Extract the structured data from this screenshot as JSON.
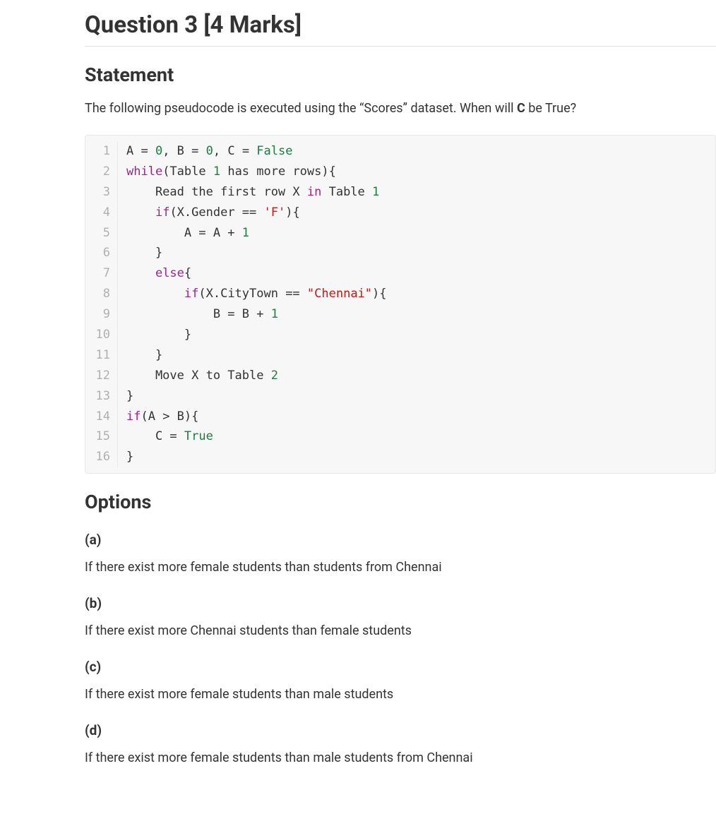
{
  "title": "Question 3 [4 Marks]",
  "sections": {
    "statement_heading": "Statement",
    "statement_text_pre": "The following pseudocode is executed using the “Scores” dataset. When will ",
    "statement_text_bold": "C",
    "statement_text_post": " be True?",
    "options_heading": "Options"
  },
  "code": {
    "lines": [
      {
        "n": "1",
        "html": "A = <span class='tok-num'>0</span>, B = <span class='tok-num'>0</span>, C = <span class='tok-const'>False</span>"
      },
      {
        "n": "2",
        "html": "<span class='tok-kw'>while</span>(Table <span class='tok-num'>1</span> has more rows){"
      },
      {
        "n": "3",
        "html": "    Read the first row X <span class='tok-kw'>in</span> Table <span class='tok-num'>1</span>"
      },
      {
        "n": "4",
        "html": "    <span class='tok-kw'>if</span>(X.Gender == <span class='tok-str'>'F'</span>){"
      },
      {
        "n": "5",
        "html": "        A = A + <span class='tok-num'>1</span>"
      },
      {
        "n": "6",
        "html": "    }"
      },
      {
        "n": "7",
        "html": "    <span class='tok-kw'>else</span>{"
      },
      {
        "n": "8",
        "html": "        <span class='tok-kw'>if</span>(X.CityTown == <span class='tok-str'>\"Chennai\"</span>){"
      },
      {
        "n": "9",
        "html": "            B = B + <span class='tok-num'>1</span>"
      },
      {
        "n": "10",
        "html": "        }"
      },
      {
        "n": "11",
        "html": "    }"
      },
      {
        "n": "12",
        "html": "    Move X to Table <span class='tok-num'>2</span>"
      },
      {
        "n": "13",
        "html": "}"
      },
      {
        "n": "14",
        "html": "<span class='tok-kw'>if</span>(A > B){"
      },
      {
        "n": "15",
        "html": "    C = <span class='tok-const'>True</span>"
      },
      {
        "n": "16",
        "html": "}"
      }
    ]
  },
  "options": [
    {
      "label": "(a)",
      "text": "If there exist more female students than students from Chennai"
    },
    {
      "label": "(b)",
      "text": "If there exist more Chennai students than female students"
    },
    {
      "label": "(c)",
      "text": "If there exist more female students than male students"
    },
    {
      "label": "(d)",
      "text": "If there exist more female students than male students from Chennai"
    }
  ]
}
